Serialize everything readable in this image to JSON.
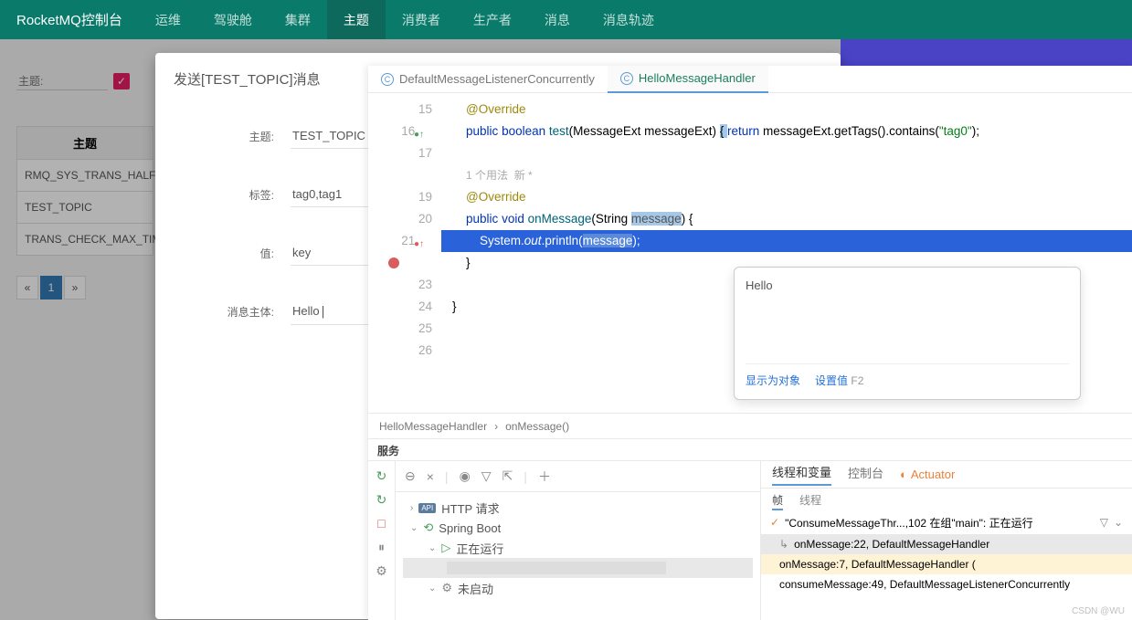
{
  "topbar": {
    "brand": "RocketMQ控制台",
    "items": [
      "运维",
      "驾驶舱",
      "集群",
      "主题",
      "消费者",
      "生产者",
      "消息",
      "消息轨迹"
    ],
    "active": 3
  },
  "sidebar": {
    "filter_label": "主题:",
    "table_header": "主题",
    "rows": [
      "RMQ_SYS_TRANS_HALF_T",
      "TEST_TOPIC",
      "TRANS_CHECK_MAX_TIME"
    ],
    "pagination": {
      "prev": "«",
      "current": "1",
      "next": "»"
    }
  },
  "modal": {
    "title": "发送[TEST_TOPIC]消息",
    "fields": {
      "topic_label": "主题:",
      "topic_value": "TEST_TOPIC",
      "tag_label": "标签:",
      "tag_value": "tag0,tag1",
      "key_label": "值:",
      "key_value": "key",
      "body_label": "消息主体:",
      "body_value": "Hello"
    }
  },
  "ide": {
    "tabs": [
      {
        "name": "DefaultMessageListenerConcurrently",
        "active": false
      },
      {
        "name": "HelloMessageHandler",
        "active": true
      }
    ],
    "lines": [
      "15",
      "16",
      "17",
      "19",
      "20",
      "21",
      "",
      "23",
      "24",
      "25",
      "26"
    ],
    "usage_hint": "1 个用法  新 *",
    "code": {
      "l15_ann": "@Override",
      "l16_kw1": "public",
      "l16_kw2": "boolean",
      "l16_fn": "test",
      "l16_p1": "(MessageExt messageExt) ",
      "l16_brace": "{ ",
      "l16_kw3": "return",
      "l16_rest": " messageExt.getTags().contains(",
      "l16_str": "\"tag0\"",
      "l16_end": ");",
      "l20_ann": "@Override",
      "l21_kw1": "public",
      "l21_kw2": "void",
      "l21_fn": "onMessage",
      "l21_p": "(String ",
      "l21_par": "message",
      "l21_end": ") {",
      "l22_a": "    System.",
      "l22_out": "out",
      "l22_b": ".println(",
      "l22_msg": "message",
      "l22_c": ");",
      "l23": "}",
      "l25": "}"
    },
    "tooltip": {
      "value": "Hello",
      "show_obj": "显示为对象",
      "set_val": "设置值",
      "shortcut": "F2"
    },
    "breadcrumb": {
      "cls": "HelloMessageHandler",
      "sep": "›",
      "method": "onMessage()"
    },
    "svc_title": "服务",
    "tree": {
      "http": "HTTP 请求",
      "spring": "Spring Boot",
      "running": "正在运行",
      "notstarted": "未启动"
    },
    "right": {
      "tab_vars": "线程和变量",
      "tab_console": "控制台",
      "actuator": "Actuator",
      "sub_frames": "帧",
      "sub_threads": "线程",
      "thread": "\"ConsumeMessageThr...,102 在组\"main\": 正在运行",
      "frames": [
        "onMessage:22, DefaultMessageHandler",
        "onMessage:7, DefaultMessageHandler (",
        "consumeMessage:49, DefaultMessageListenerConcurrently"
      ]
    }
  },
  "watermark": "CSDN @WU"
}
